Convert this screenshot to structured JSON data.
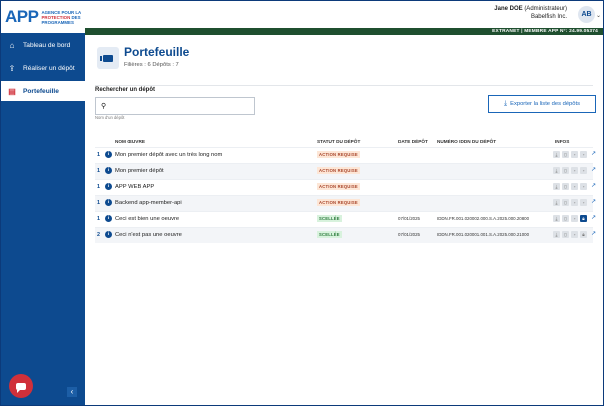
{
  "sidebar": {
    "logo": {
      "mark": "APP",
      "line1": "AGENCE POUR LA",
      "line2": "PROTECTION",
      "line3_a": "DES",
      "line4": "PROGRAMMES"
    },
    "items": [
      {
        "label": "Tableau de bord",
        "icon": "home-icon"
      },
      {
        "label": "Réaliser un dépôt",
        "icon": "upload-icon"
      },
      {
        "label": "Portefeuille",
        "icon": "portfolio-icon",
        "active": true
      }
    ]
  },
  "topbar": {
    "user_name": "Jane DOE",
    "user_role": "(Administrateur)",
    "company": "Babelfish Inc.",
    "avatar": "AB",
    "env_badge": "EXTRANET | MEMBRE APP N°: 24.99.05374"
  },
  "page": {
    "title": "Portefeuille",
    "subtitle": "Filières : 6   Dépôts : 7"
  },
  "search": {
    "label": "Rechercher un dépôt",
    "placeholder": "",
    "hint": "Nom d'un dépôt"
  },
  "export_label": "Exporter la liste des dépôts",
  "table": {
    "headers": {
      "name": "NOM ŒUVRE",
      "status": "STATUT DU DÉPÔT",
      "date": "DATE DÉPÔT",
      "idn": "NUMÉRO IDDN DU DÉPÔT",
      "infos": "INFOS"
    },
    "rows": [
      {
        "num": "1",
        "name": "Mon premier dépôt avec un très long nom",
        "status": "ACTION REQUISE",
        "status_type": "warn",
        "date": "",
        "idn": ""
      },
      {
        "num": "1",
        "name": "Mon premier dépôt",
        "status": "ACTION REQUISE",
        "status_type": "warn",
        "date": "",
        "idn": ""
      },
      {
        "num": "1",
        "name": "APP WEB APP",
        "status": "ACTION REQUISE",
        "status_type": "warn",
        "date": "",
        "idn": ""
      },
      {
        "num": "1",
        "name": "Backend app-member-api",
        "status": "ACTION REQUISE",
        "status_type": "warn",
        "date": "",
        "idn": ""
      },
      {
        "num": "1",
        "name": "Ceci est bien une oeuvre",
        "status": "SCELLÉE",
        "status_type": "ok",
        "date": "07/01/2025",
        "idn": "IDDN.FR.001.020002.000.S.A.2025.000.20800"
      },
      {
        "num": "2",
        "name": "Ceci n'est pas une oeuvre",
        "status": "SCELLÉE",
        "status_type": "ok",
        "date": "07/01/2025",
        "idn": "IDDN.FR.001.020001.001.S.A.2025.000.21000"
      }
    ]
  },
  "colors": {
    "primary": "#0d4a8f",
    "accent": "#d0303a",
    "env": "#1f4f2f"
  }
}
